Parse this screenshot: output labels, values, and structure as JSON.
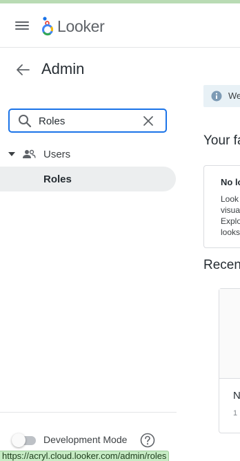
{
  "header": {
    "logo_text": "Looker",
    "menu_icon": "hamburger-menu-icon"
  },
  "sidebar": {
    "title": "Admin",
    "search": {
      "value": "Roles",
      "placeholder": "Search"
    },
    "tree": [
      {
        "label": "Users",
        "icon": "people-icon",
        "expanded": true
      },
      {
        "label": "Roles",
        "selected": true
      }
    ],
    "footer": {
      "dev_mode_label": "Development Mode",
      "dev_mode_on": false
    }
  },
  "main": {
    "banner_text": "We",
    "favorites_title": "Your fa",
    "favorites_card": {
      "title": "No lo",
      "body": [
        "Look",
        "visua",
        "Explo",
        "looks"
      ]
    },
    "recents_title": "Recent",
    "recent_card": {
      "name": "N",
      "meta": "1"
    }
  },
  "status_bar": {
    "url": "https://acryl.cloud.looker.com/admin/roles"
  },
  "colors": {
    "accent": "#1a73e8",
    "selected_row": "#eceeef",
    "banner": "#e8f1f6",
    "status_bar": "#c7ecc5"
  }
}
